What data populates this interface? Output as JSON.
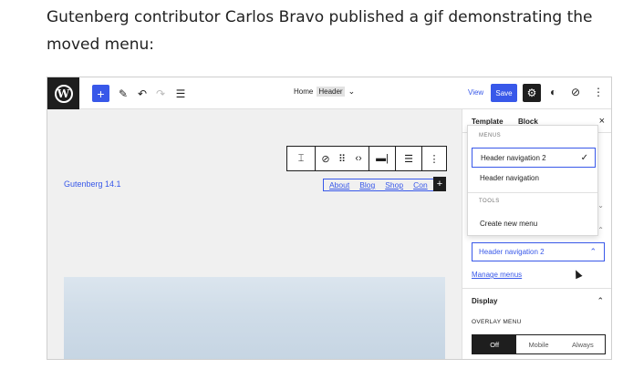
{
  "article": {
    "text": "Gutenberg contributor Carlos Bravo published a gif demonstrating the moved menu:"
  },
  "editor": {
    "topbar": {
      "logo": "W",
      "add_label": "+",
      "center_page": "Home",
      "center_tag": "Header",
      "view_label": "View",
      "save_label": "Save"
    },
    "canvas": {
      "site_title": "Gutenberg 14.1",
      "nav_links": [
        "About",
        "Blog",
        "Shop",
        "Con"
      ],
      "nav_add": "+"
    },
    "sidebar": {
      "tab_template": "Template",
      "tab_block": "Block",
      "close": "×",
      "selected_menu": "Header navigation 2",
      "manage_menus": "Manage menus",
      "display_heading": "Display",
      "overlay_heading": "OVERLAY MENU",
      "overlay_options": [
        "Off",
        "Mobile",
        "Always"
      ],
      "overlay_selected": "Off"
    },
    "dropdown": {
      "menus_heading": "MENUS",
      "menu_items": [
        "Header navigation 2",
        "Header navigation"
      ],
      "selected_item": "Header navigation 2",
      "tools_heading": "TOOLS",
      "tools_items": [
        "Create new menu"
      ]
    },
    "colors": {
      "accent": "#3858e9",
      "dark": "#1e1e1e"
    }
  }
}
